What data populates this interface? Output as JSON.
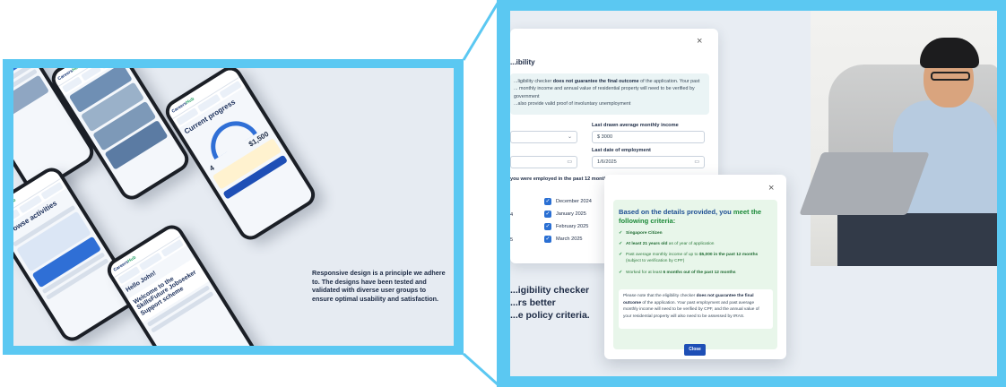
{
  "left_panel": {
    "caption": "Responsive design is a principle we adhere to. The designs have been tested and validated with diverse user groups to ensure optimal usability and satisfaction.",
    "phones": {
      "progress_title": "Current progress",
      "browse_title": "Browse activities",
      "hello_title": "Hello John!",
      "welcome_title": "Welcome to the SkillsFuture Jobseeker Support scheme",
      "progress_amount": "$1,500",
      "progress_count": "4",
      "logo_main": "Careers",
      "logo_accent": "Hub"
    }
  },
  "eligibility_form": {
    "title": "...ibility",
    "note_prefix": "...ligibility checker ",
    "note_bold": "does not guarantee the final outcome",
    "note_suffix": " of the application. Your past",
    "note_line2": "... monthly income and annual value of residential property will need to be verified by government",
    "note_line3": "...also provide valid proof of involuntary unemployment",
    "income_label": "Last drawn average monthly income",
    "income_value": "$ 3000",
    "employment_date_label": "Last date of employment",
    "employment_date_value": "1/6/2025",
    "employed_question": "you were employed in the past 12 months.",
    "months": [
      "December 2024",
      "January 2025",
      "February 2025",
      "March 2025"
    ],
    "left_truncs": [
      "4",
      "5"
    ],
    "close_glyph": "×"
  },
  "headline": {
    "line1": "...igibility checker",
    "line2": "...rs better",
    "line3": "...e policy criteria."
  },
  "result_modal": {
    "close_glyph": "×",
    "title_prefix": "Based on the details provided, you ",
    "title_bold": "meet the following criteria:",
    "criteria": [
      {
        "pre": "",
        "bold": "Singapore Citizen",
        "post": ""
      },
      {
        "pre": "",
        "bold": "At least 21 years old",
        "post": " as of year of application"
      },
      {
        "pre": "Past average monthly income of up to ",
        "bold": "$5,000 in the past 12 months",
        "post": " (subject to verification by CPF)"
      },
      {
        "pre": "Worked for at least ",
        "bold": "6 months out of the past 12 months",
        "post": ""
      }
    ],
    "note_pre": "Please note that the eligibility checker ",
    "note_bold": "does not guarantee the final outcome",
    "note_post": " of the application. Your past employment and past average monthly income will need to be verified by CPF, and the annual value of your residential property will also need to be assessed by IRAS.",
    "close_button": "Close"
  },
  "colors": {
    "frame": "#5bc8f2",
    "primary": "#1e4fb6",
    "success": "#1d8a3a"
  }
}
